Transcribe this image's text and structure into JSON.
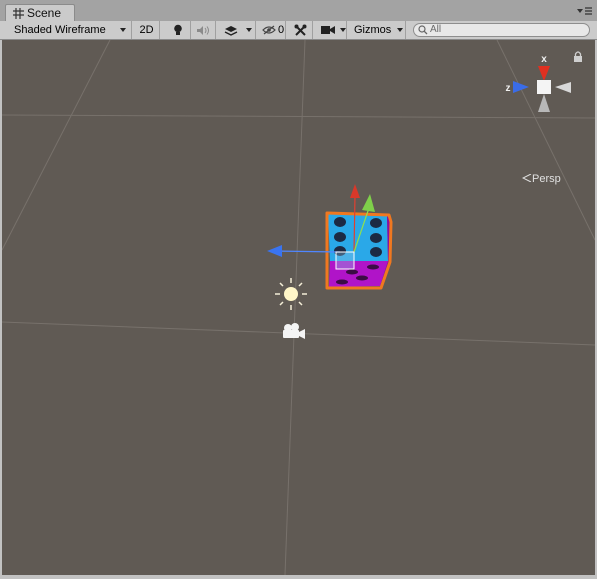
{
  "tab": {
    "title": "Scene",
    "icon": "scene-grid-icon"
  },
  "toolbar": {
    "draw_mode": "Shaded Wireframe",
    "mode_2d": "2D",
    "hidden_count": "0",
    "gizmos": "Gizmos",
    "search_placeholder": "All"
  },
  "viewport": {
    "projection": "Persp",
    "axis_z": "z",
    "axis_x": "x",
    "background": "#605a54",
    "selection_color": "#f07820",
    "dice_top_color": "#2aa8e8",
    "dice_side_color": "#b014c8"
  }
}
